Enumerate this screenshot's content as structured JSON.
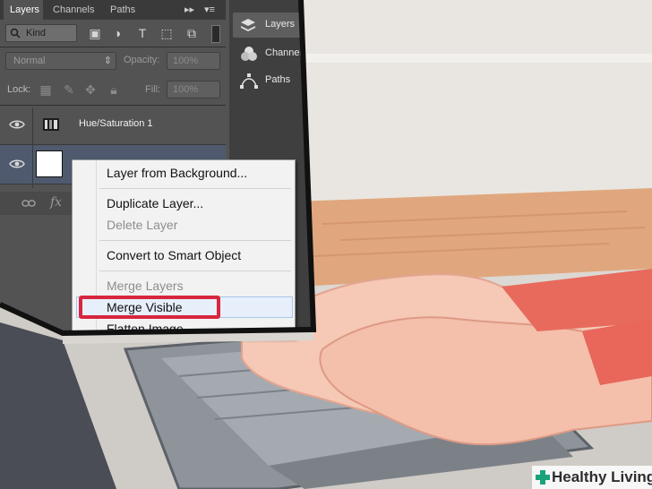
{
  "layers_panel": {
    "tabs": [
      "Layers",
      "Channels",
      "Paths"
    ],
    "filter_kind": "Kind",
    "blend_mode": "Normal",
    "opacity_label": "Opacity:",
    "opacity_value": "100%",
    "lock_label": "Lock:",
    "fill_label": "Fill:",
    "fill_value": "100%",
    "layers": [
      {
        "name": "Hue/Saturation 1"
      },
      {
        "name": ""
      }
    ]
  },
  "dock": {
    "items": [
      {
        "label": "Layers",
        "icon": "layers-icon"
      },
      {
        "label": "Channels",
        "icon": "channels-icon"
      },
      {
        "label": "Paths",
        "icon": "paths-icon"
      }
    ]
  },
  "context_menu": {
    "items": [
      {
        "label": "Layer from Background...",
        "enabled": true
      },
      {
        "label": "Duplicate Layer...",
        "enabled": true
      },
      {
        "label": "Delete Layer",
        "enabled": false
      },
      {
        "label": "Convert to Smart Object",
        "enabled": true
      },
      {
        "label": "Merge Layers",
        "enabled": false
      },
      {
        "label": "Merge Visible",
        "enabled": true,
        "highlighted": true
      },
      {
        "label": "Flatten Image",
        "enabled": true
      }
    ]
  },
  "watermark": {
    "text": "Healthy Living"
  },
  "colors": {
    "panel": "#535353",
    "highlight_box": "#d7263d",
    "watermark_cross": "#1aa37a"
  }
}
